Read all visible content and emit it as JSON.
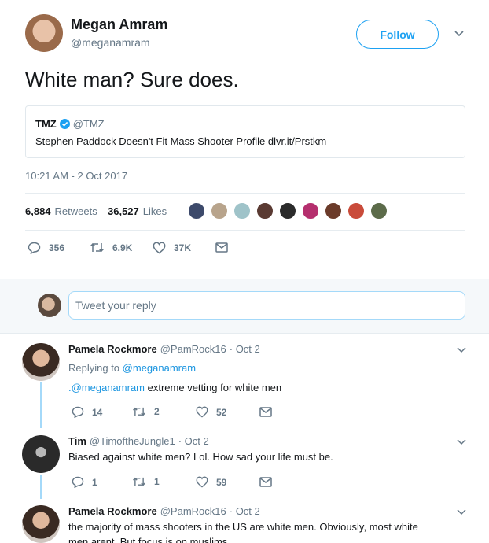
{
  "tweet": {
    "author": {
      "name": "Megan Amram",
      "handle": "@meganamram"
    },
    "follow_label": "Follow",
    "text": "White man? Sure does.",
    "quote": {
      "author": "TMZ",
      "handle": "@TMZ",
      "text": "Stephen Paddock Doesn't Fit Mass Shooter Profile dlvr.it/Prstkm"
    },
    "timestamp": "10:21 AM - 2 Oct 2017",
    "stats": {
      "retweets": "6,884",
      "retweets_label": "Retweets",
      "likes": "36,527",
      "likes_label": "Likes"
    },
    "actions": {
      "replies": "356",
      "retweets": "6.9K",
      "likes": "37K"
    }
  },
  "reply_box": {
    "placeholder": "Tweet your reply"
  },
  "replies": [
    {
      "name": "Pamela Rockmore",
      "handle": "@PamRock16",
      "date": "· Oct 2",
      "replying_prefix": "Replying to",
      "replying_to": "@meganamram",
      "mention": ".@meganamram",
      "text": " extreme vetting for white men",
      "replies": "14",
      "retweets": "2",
      "likes": "52"
    },
    {
      "name": "Tim",
      "handle": "@TimoftheJungle1",
      "date": "· Oct 2",
      "text": "Biased against white men? Lol. How sad your life must be.",
      "replies": "1",
      "retweets": "1",
      "likes": "59"
    },
    {
      "name": "Pamela Rockmore",
      "handle": "@PamRock16",
      "date": "· Oct 2",
      "text_line1": "the majority of mass shooters in the US are white men. Obviously, most white",
      "text_line2": "men arent. But focus is on muslims."
    }
  ],
  "colors": {
    "accent": "#1da1f2",
    "link": "#1b95e0",
    "muted": "#657786",
    "thread": "#a4d9f9",
    "divider": "#e6ecf0"
  },
  "icons": [
    "verified-badge-icon",
    "chevron-down-icon",
    "reply-icon",
    "retweet-icon",
    "like-icon",
    "message-icon"
  ]
}
